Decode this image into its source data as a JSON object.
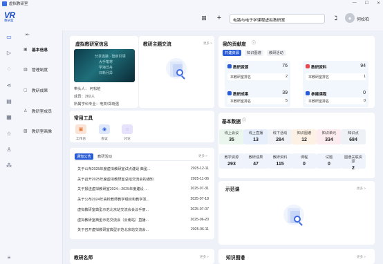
{
  "app": {
    "title": "虚拟教研室",
    "logo_big": "VR",
    "logo_small": "教研室"
  },
  "header": {
    "search_value": "电路与电子学课程虚拟教研室",
    "username": "何松柏",
    "add": "+"
  },
  "submenu": {
    "items": [
      {
        "label": "基本信息"
      },
      {
        "label": "管理制度"
      },
      {
        "label": "教研成果"
      },
      {
        "label": "教研室成员"
      },
      {
        "label": "教研室画像"
      }
    ]
  },
  "info_card": {
    "title": "虚拟教研室信息",
    "banner_text": [
      "分享连接 · 智启引领",
      "大手笔将",
      "学海泛舟",
      "日新月异"
    ],
    "leader": "带头人：  何松柏",
    "members": "成员：202人",
    "affiliation": "所属学科专业：电类/郑晓强"
  },
  "theme_card": {
    "title": "教研主题交流",
    "more": "更多 >"
  },
  "contrib_card": {
    "title": "我的贡献度",
    "tabs": [
      "共建资源",
      "知识图谱",
      "教研活动"
    ],
    "items": [
      {
        "name": "教研资源",
        "value": "76",
        "rank_label": "本教研室排名",
        "rank": "2",
        "color": "#2a5bd7"
      },
      {
        "name": "教研资料",
        "value": "94",
        "rank_label": "本教研室排名",
        "rank": "1",
        "color": "#e5484d"
      },
      {
        "name": "教研成果",
        "value": "39",
        "rank_label": "本教研室排名",
        "rank": "5",
        "color": "#2a5bd7"
      },
      {
        "name": "参建课程",
        "value": "0",
        "rank_label": "本教研室排名",
        "rank": "0",
        "color": "#2a5bd7"
      }
    ]
  },
  "tools_card": {
    "title": "常用工具",
    "items": [
      {
        "label": "工作台",
        "color": "#fbe3d6",
        "glyph_color": "#e07a3a"
      },
      {
        "label": "会议",
        "color": "#dfe8fb",
        "glyph_color": "#2a5bd7"
      },
      {
        "label": "讨论",
        "color": "#e6e2fb",
        "glyph_color": "#7b5ce0"
      }
    ]
  },
  "notice_card": {
    "tabs": [
      "通知公告",
      "教研活动"
    ],
    "more": "更多 >",
    "rows": [
      {
        "title": "关于公布2025年度虚拟教研室试点建设 典型...",
        "date": "2025-12-11"
      },
      {
        "title": "关于召开2025年度虚拟教研室总结交流会的通知",
        "date": "2025-11-06"
      },
      {
        "title": "关于报送虚拟教研室2024—2025年度建设 ...",
        "date": "2025-07-31"
      },
      {
        "title": "关于公布2024年高校教师教学组织和教学发...",
        "date": "2025-07-18"
      },
      {
        "title": "虚拟教研室典型示范北京站交流会会议手册...",
        "date": "2025-07-07"
      },
      {
        "title": "虚拟教研室典型示范交流会（云南站）直播...",
        "date": "2025-06-20"
      },
      {
        "title": "关于召开虚拟教研室典型示范北京站交流会...",
        "date": "2025-06-11"
      }
    ]
  },
  "basic_data": {
    "title": "基本数据",
    "row1": [
      {
        "label": "线上会议",
        "value": "35"
      },
      {
        "label": "线上直播",
        "value": "13"
      },
      {
        "label": "线下活动",
        "value": "284"
      },
      {
        "label": "知识图谱",
        "value": "12"
      },
      {
        "label": "知识单元",
        "value": "334"
      },
      {
        "label": "知识点",
        "value": "684"
      }
    ],
    "row2": [
      {
        "label": "教学资源",
        "value": "293"
      },
      {
        "label": "教研成果",
        "value": "47"
      },
      {
        "label": "教研资料",
        "value": "115"
      },
      {
        "label": "课程",
        "value": "0"
      },
      {
        "label": "试题",
        "value": "0"
      },
      {
        "label": "图谱关联资源",
        "value": "2"
      }
    ]
  },
  "demo_card": {
    "title": "示范课",
    "more": "更多 >"
  },
  "teachers_card": {
    "title": "教研名师",
    "more": "更多 >"
  },
  "graph_card": {
    "title": "知识图谱",
    "more": "更多 >"
  }
}
